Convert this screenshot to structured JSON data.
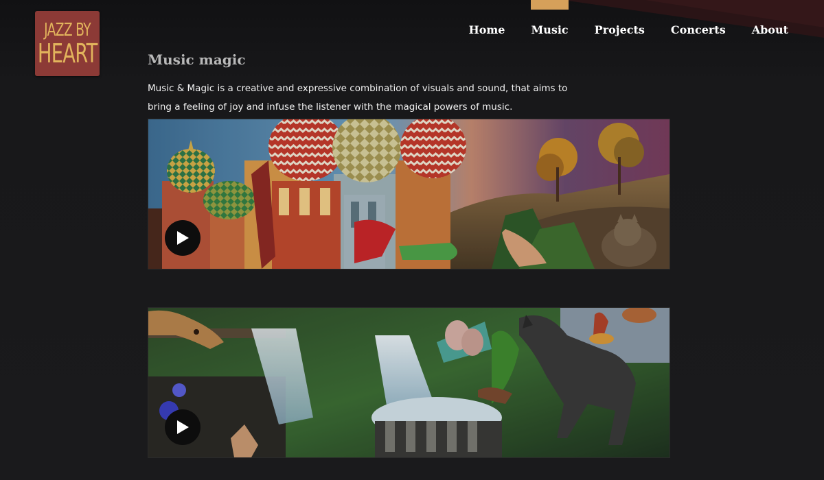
{
  "brand": {
    "logo_line1": "JAZZ BY",
    "logo_line2": "HEART",
    "logo_bg": "#8c3a36",
    "logo_fg": "#e2b45c"
  },
  "nav": {
    "items": [
      {
        "label": "Home",
        "active": false
      },
      {
        "label": "Music",
        "active": true
      },
      {
        "label": "Projects",
        "active": false
      },
      {
        "label": "Concerts",
        "active": false
      },
      {
        "label": "About",
        "active": false
      }
    ],
    "active_indicator_color": "#d6a05a"
  },
  "page": {
    "title": "Music magic",
    "intro": "Music & Magic is a creative and expressive combination of visuals and sound, that aims to bring a feeling of joy and infuse the listener with the magical powers of music."
  },
  "videos": [
    {
      "thumbnail_icon": "collage-cathedral-landscape",
      "play_icon": "play-icon"
    },
    {
      "thumbnail_icon": "collage-waterfall-horse",
      "play_icon": "play-icon"
    }
  ],
  "colors": {
    "background": "#19191b",
    "text": "#f2f2f2",
    "heading": "#b9b9b9"
  }
}
